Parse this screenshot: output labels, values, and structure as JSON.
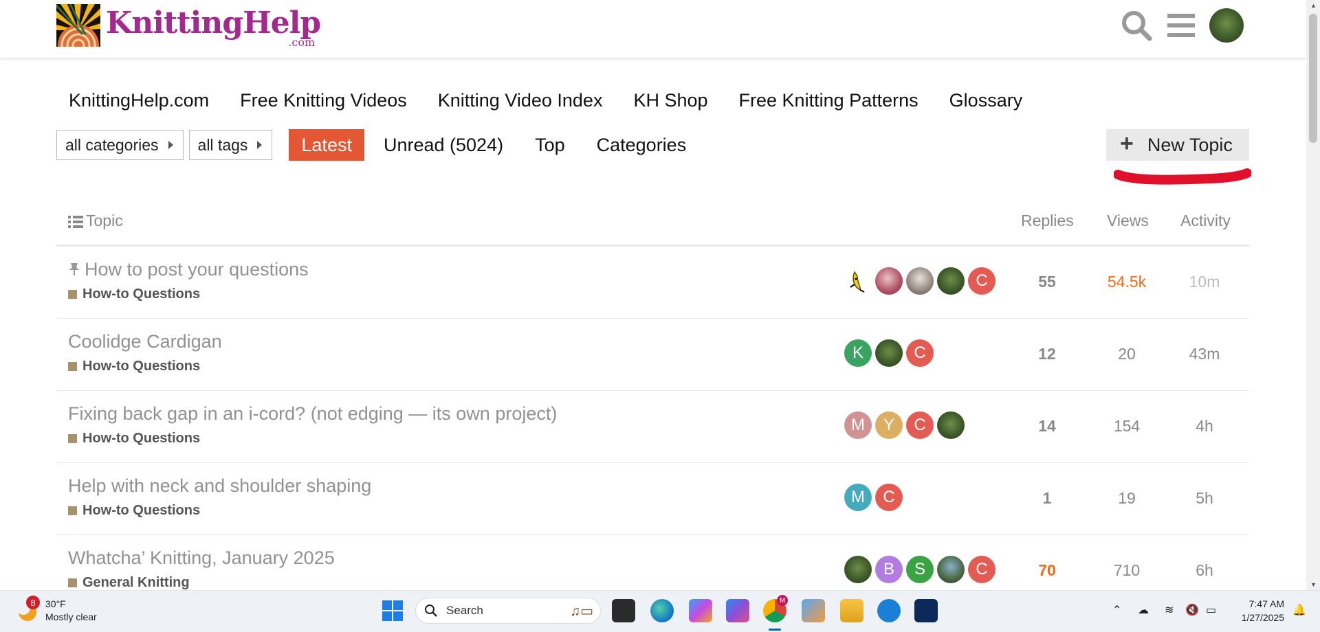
{
  "header": {
    "logo_main": "KnittingHelp",
    "logo_sub": ".com"
  },
  "site_nav": [
    "KnittingHelp.com",
    "Free Knitting Videos",
    "Knitting Video Index",
    "KH Shop",
    "Free Knitting Patterns",
    "Glossary"
  ],
  "filters": {
    "categories": "all categories",
    "tags": "all tags"
  },
  "tabs": [
    "Latest",
    "Unread (5024)",
    "Top",
    "Categories"
  ],
  "new_topic_label": "New Topic",
  "table_headers": {
    "topic": "Topic",
    "replies": "Replies",
    "views": "Views",
    "activity": "Activity"
  },
  "topics": [
    {
      "title": "How to post your questions",
      "category": "How-to Questions",
      "replies": "55",
      "views": "54.5k",
      "activity": "10m",
      "pinned": true
    },
    {
      "title": "Coolidge Cardigan",
      "category": "How-to Questions",
      "replies": "12",
      "views": "20",
      "activity": "43m"
    },
    {
      "title": "Fixing back gap in an i-cord? (not edging — its own project)",
      "category": "How-to Questions",
      "replies": "14",
      "views": "154",
      "activity": "4h"
    },
    {
      "title": "Help with neck and shoulder shaping",
      "category": "How-to Questions",
      "replies": "1",
      "views": "19",
      "activity": "5h"
    },
    {
      "title": "Whatcha’ Knitting, January 2025",
      "category": "General Knitting",
      "replies": "70",
      "views": "710",
      "activity": "6h"
    }
  ],
  "posters": {
    "row2_k": "K",
    "c": "C",
    "m": "M",
    "y": "Y",
    "b": "B",
    "s": "S"
  },
  "taskbar": {
    "weather_badge": "8",
    "temp": "30°F",
    "condition": "Mostly clear",
    "search_label": "Search",
    "time": "7:47 AM",
    "date": "1/27/2025",
    "chrome_badge": "M"
  },
  "colors": {
    "accent": "#e45735",
    "logo": "#a3298f",
    "category": "#a8926a",
    "hot": "#f06b19",
    "underline": "#e0102a"
  }
}
